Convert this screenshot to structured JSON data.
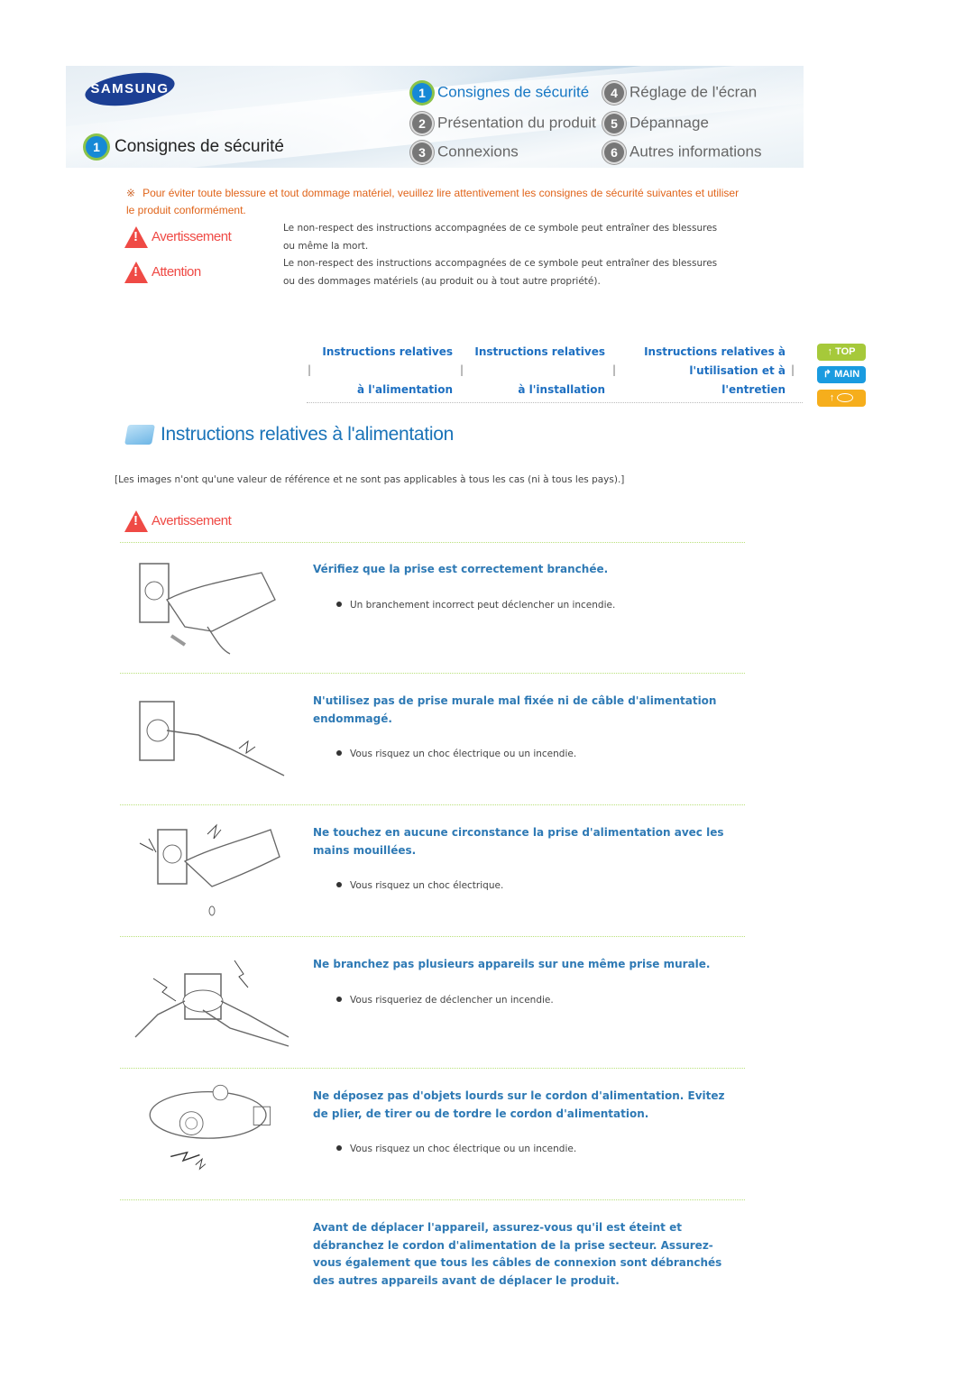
{
  "header": {
    "brand": "SAMSUNG",
    "page_title_number": "1",
    "page_title": "Consignes de sécurité",
    "menu": [
      {
        "number": "1",
        "label": "Consignes de sécurité",
        "active": true
      },
      {
        "number": "2",
        "label": "Présentation du produit",
        "active": false
      },
      {
        "number": "3",
        "label": "Connexions",
        "active": false
      },
      {
        "number": "4",
        "label": "Réglage de l'écran",
        "active": false
      },
      {
        "number": "5",
        "label": "Dépannage",
        "active": false
      },
      {
        "number": "6",
        "label": "Autres informations",
        "active": false
      }
    ]
  },
  "intro": {
    "mark": "※",
    "text": "Pour éviter toute blessure et tout dommage matériel, veuillez lire attentivement les consignes de sécurité suivantes et utiliser le produit conformément.",
    "legend": [
      {
        "icon": "warning-triangle-icon",
        "label": "Avertissement",
        "description": "Le non-respect des instructions accompagnées de ce symbole peut entraîner des blessures ou même la mort."
      },
      {
        "icon": "caution-triangle-icon",
        "label": "Attention",
        "description": "Le non-respect des instructions accompagnées de ce symbole peut entraîner des blessures ou des dommages matériels (au produit ou à tout autre propriété)."
      }
    ]
  },
  "section_nav": {
    "links": [
      {
        "line1": "Instructions relatives",
        "line2": "",
        "line3": "à l'alimentation"
      },
      {
        "line1": "Instructions relatives",
        "line2": "",
        "line3": "à l'installation"
      },
      {
        "line1": "Instructions relatives à",
        "line2": "l'utilisation et à",
        "line3": "l'entretien"
      }
    ],
    "separator": "|",
    "side_buttons": [
      {
        "label": "TOP",
        "icon": "arrow-up-icon",
        "color": "#a6c93a"
      },
      {
        "label": "MAIN",
        "icon": "arrow-turn-icon",
        "color": "#1a9be0"
      },
      {
        "label": "",
        "icon": "arrow-up-icon",
        "secondary_icon": "lips-icon",
        "color": "#f6ae1c"
      }
    ]
  },
  "section": {
    "title": "Instructions relatives à l'alimentation",
    "disclaimer": "[Les images n'ont qu'une valeur de référence et ne sont pas applicables à tous les cas (ni à tous les pays).]",
    "warning_label": "Avertissement",
    "items": [
      {
        "title": "Vérifiez que la prise est correctement branchée.",
        "bullet": "Un branchement incorrect peut déclencher un incendie.",
        "illustration": "hand-plugging-outlet-illustration"
      },
      {
        "title": "N'utilisez pas de prise murale mal fixée ni de câble d'alimentation endommagé.",
        "bullet": "Vous risquez un choc électrique ou un incendie.",
        "illustration": "damaged-cable-outlet-illustration"
      },
      {
        "title": "Ne touchez en aucune circonstance la prise d'alimentation avec les mains mouillées.",
        "bullet": "Vous risquez un choc électrique.",
        "illustration": "wet-hand-outlet-illustration"
      },
      {
        "title": "Ne branchez pas plusieurs appareils sur une même prise murale.",
        "bullet": "Vous risqueriez de déclencher un incendie.",
        "illustration": "overloaded-outlet-illustration"
      },
      {
        "title": "Ne déposez pas d'objets lourds sur le cordon d'alimentation. Evitez de plier, de tirer ou de tordre le cordon d'alimentation.",
        "bullet": "Vous risquez un choc électrique ou un incendie.",
        "illustration": "projector-on-cord-illustration"
      },
      {
        "title": "Avant de déplacer l'appareil, assurez-vous qu'il est éteint et débranchez le cordon d'alimentation de la prise secteur. Assurez-vous également que tous les câbles de connexion sont débranchés des autres appareils avant de déplacer le produit.",
        "bullet": "",
        "illustration": ""
      }
    ]
  }
}
